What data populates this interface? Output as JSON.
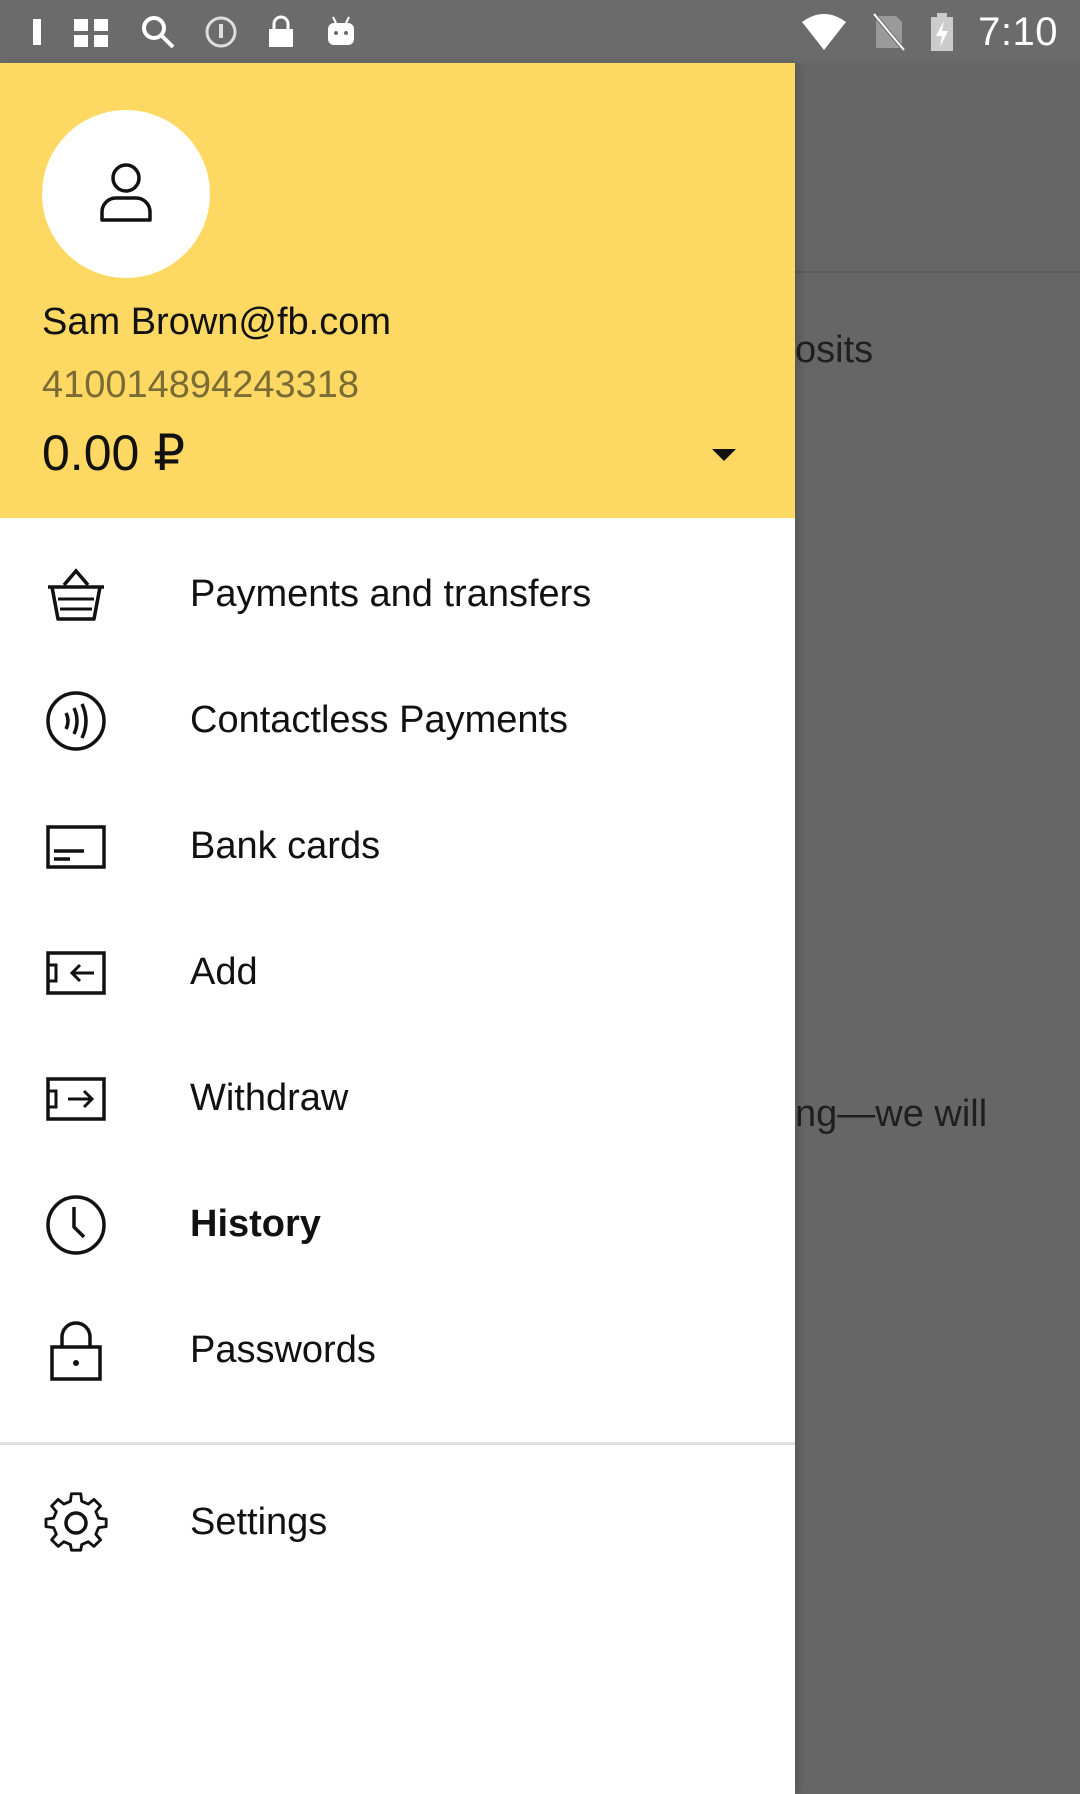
{
  "status_bar": {
    "time": "7:10",
    "left_icons": [
      "notification-icon",
      "grid-icon",
      "search-icon",
      "info-icon",
      "lock-icon",
      "android-icon"
    ],
    "right_icons": [
      "wifi-icon",
      "no-sim-icon",
      "battery-charging-icon"
    ]
  },
  "drawer": {
    "header": {
      "email": "Sam Brown@fb.com",
      "account_number": "410014894243318",
      "balance": "0.00 ₽"
    },
    "menu": [
      {
        "label": "Payments and transfers",
        "icon": "basket-icon"
      },
      {
        "label": "Contactless Payments",
        "icon": "contactless-icon"
      },
      {
        "label": "Bank cards",
        "icon": "card-icon"
      },
      {
        "label": "Add",
        "icon": "add-funds-icon"
      },
      {
        "label": "Withdraw",
        "icon": "withdraw-icon"
      },
      {
        "label": "History",
        "icon": "clock-icon"
      },
      {
        "label": "Passwords",
        "icon": "lock-icon"
      }
    ],
    "settings": {
      "label": "Settings",
      "icon": "gear-icon"
    }
  },
  "background": {
    "text_1": "osits",
    "text_2": "ng—we will"
  },
  "colors": {
    "header_bg": "#fdd963",
    "scrim": "#666666",
    "drawer_bg": "#ffffff",
    "divider": "#e0e0e0"
  }
}
